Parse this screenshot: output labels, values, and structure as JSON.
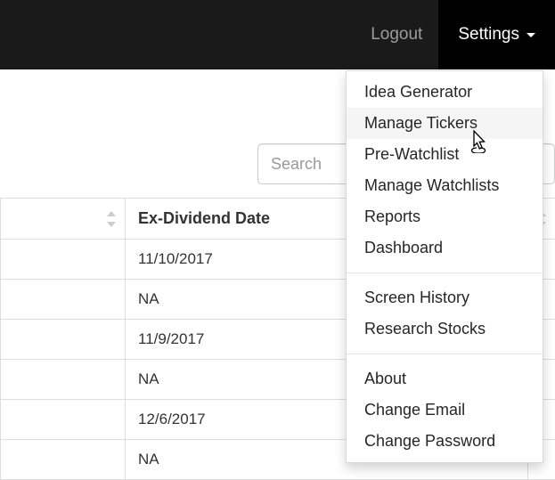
{
  "nav": {
    "logout": "Logout",
    "settings": "Settings"
  },
  "search": {
    "placeholder": "Search"
  },
  "table": {
    "header": "Ex-Dividend Date",
    "rows": [
      "11/10/2017",
      "NA",
      "11/9/2017",
      "NA",
      "12/6/2017",
      "NA"
    ]
  },
  "dropdown": {
    "group1": [
      "Idea Generator",
      "Manage Tickers",
      "Pre-Watchlist",
      "Manage Watchlists",
      "Reports",
      "Dashboard"
    ],
    "group2": [
      "Screen History",
      "Research Stocks"
    ],
    "group3": [
      "About",
      "Change Email",
      "Change Password"
    ]
  }
}
